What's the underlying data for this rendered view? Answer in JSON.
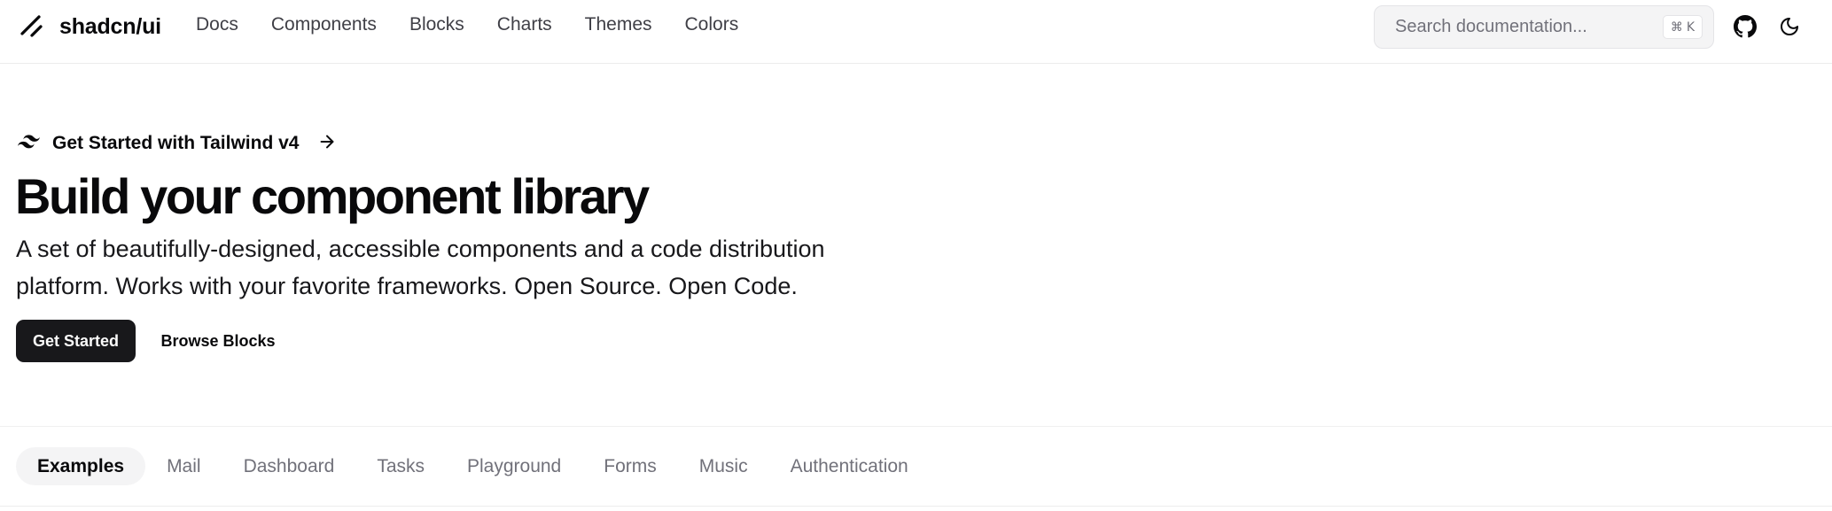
{
  "header": {
    "brand": "shadcn/ui",
    "nav": [
      "Docs",
      "Components",
      "Blocks",
      "Charts",
      "Themes",
      "Colors"
    ],
    "search": {
      "placeholder": "Search documentation...",
      "shortcut_symbol": "⌘",
      "shortcut_key": "K"
    },
    "icons": {
      "logo": "slash-logo-icon",
      "github": "github-icon",
      "theme_toggle": "moon-icon"
    }
  },
  "hero": {
    "announcement": "Get Started with Tailwind v4",
    "announcement_icons": [
      "tailwind-icon",
      "arrow-right-icon"
    ],
    "title": "Build your component library",
    "description": "A set of beautifully-designed, accessible components and a code distribution platform. Works with your favorite frameworks. Open Source. Open Code.",
    "primary_button": "Get Started",
    "secondary_button": "Browse Blocks"
  },
  "examples": {
    "tabs": [
      "Examples",
      "Mail",
      "Dashboard",
      "Tasks",
      "Playground",
      "Forms",
      "Music",
      "Authentication"
    ],
    "active_tab": "Examples"
  },
  "colors": {
    "primary": "#18181b",
    "muted_bg": "#f4f4f5",
    "muted_text": "#71717a",
    "border": "#e4e4e7"
  }
}
